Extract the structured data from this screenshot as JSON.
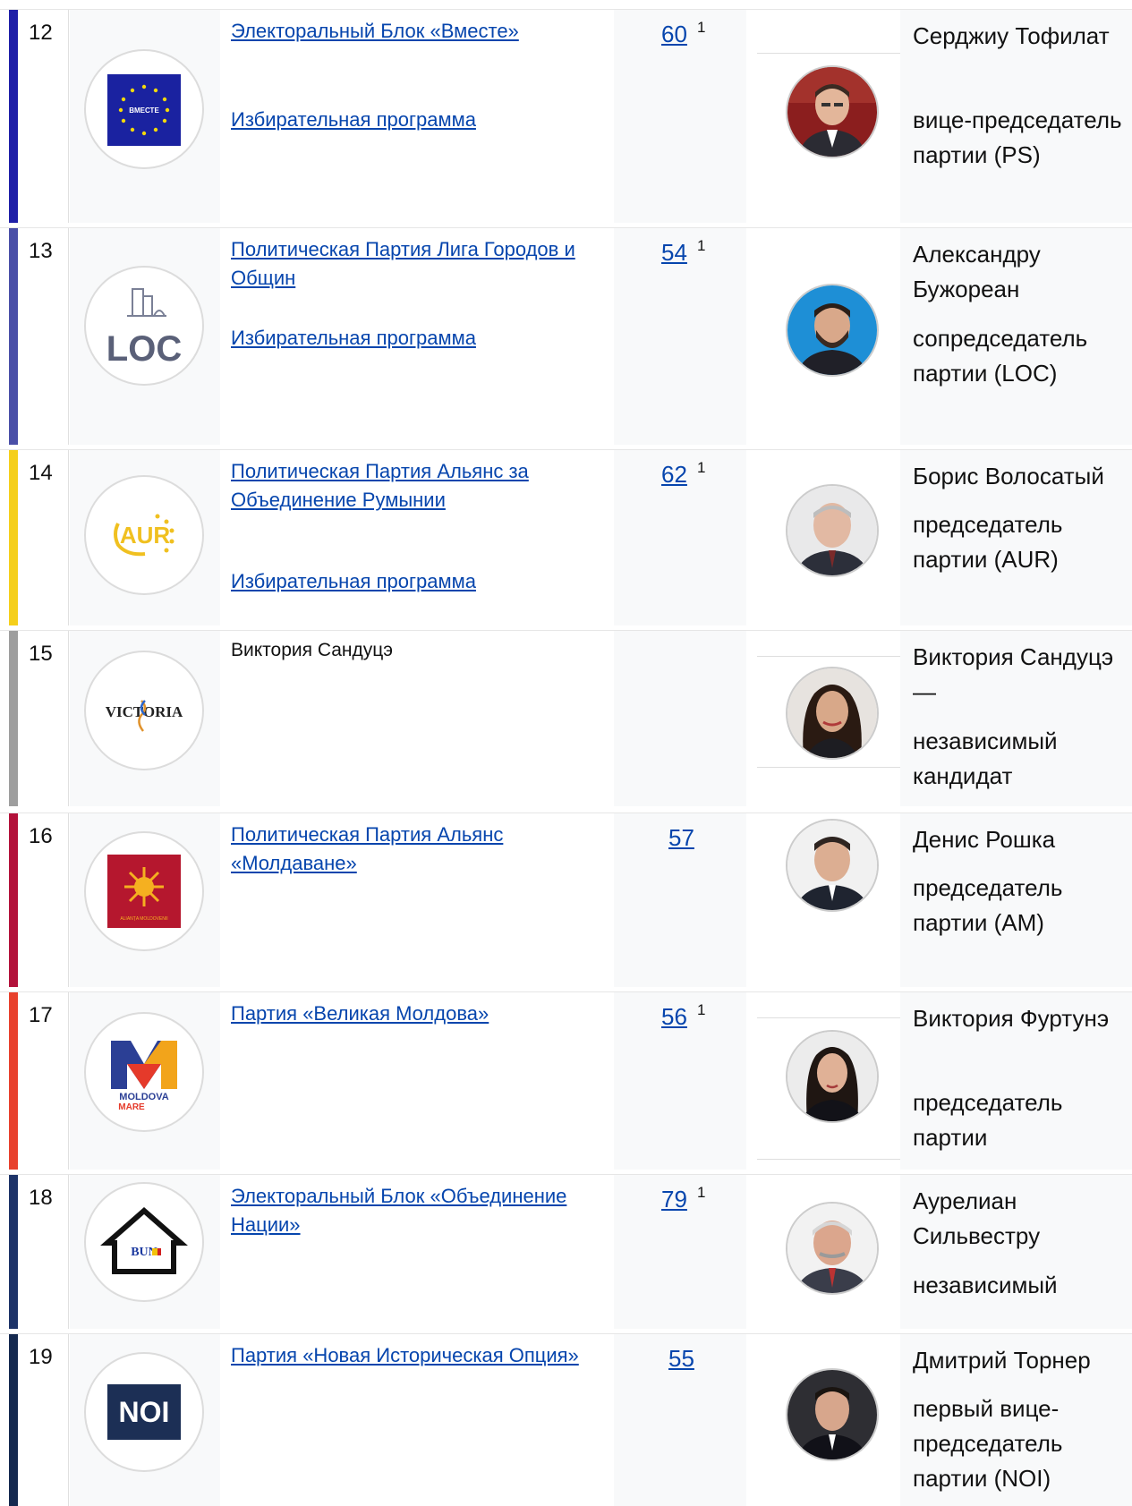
{
  "rows": [
    {
      "num": "12",
      "party": "Электоральный Блок «Вместе»",
      "program": "Избирательная программа",
      "seats": "60",
      "note": "1",
      "leader": "Серджиу Тофилат",
      "role": "вице-председатель партии (PS)",
      "stripe": "#1f1fa8"
    },
    {
      "num": "13",
      "party": "Политическая Партия Лига Городов и Общин",
      "program": "Избирательная программа",
      "seats": "54",
      "note": "1",
      "leader": "Александру Бужореан",
      "role": "сопредседатель партии (LOC)",
      "stripe": "#4a4fa8"
    },
    {
      "num": "14",
      "party": "Политическая Партия Альянс за Объединение Румынии",
      "program": "Избирательная программа",
      "seats": "62",
      "note": "1",
      "leader": "Борис Волосатый",
      "role": "председатель партии (AUR)",
      "stripe": "#f5cf1b"
    },
    {
      "num": "15",
      "party": "Виктория Сандуцэ",
      "program": "",
      "seats": "",
      "note": "",
      "leader": "Виктория Сандуцэ —",
      "role": "независимый кандидат",
      "stripe": "#9e9e9e"
    },
    {
      "num": "16",
      "party": "Политическая Партия Альянс «Молдаване»",
      "program": "",
      "seats": "57",
      "note": "",
      "leader": "Денис Рошка",
      "role": "председатель партии (AM)",
      "stripe": "#b3123b"
    },
    {
      "num": "17",
      "party": "Партия «Великая Молдова»",
      "program": "",
      "seats": "56",
      "note": "1",
      "leader": "Виктория Фуртунэ",
      "role": "председатель партии",
      "stripe": "#e8412d"
    },
    {
      "num": "18",
      "party": "Электоральный Блок «Объединение Нации»",
      "program": "",
      "seats": "79",
      "note": "1",
      "leader": "Аурелиан Сильвестру",
      "role": "независимый",
      "stripe": "#1d3368"
    },
    {
      "num": "19",
      "party": "Партия «Новая Историческая Опция»",
      "program": "",
      "seats": "55",
      "note": "",
      "leader": "Дмитрий Торнер",
      "role": "первый вице-председатель партии (NOI)",
      "stripe": "#15294f"
    }
  ],
  "logos": {
    "eu_caption": "ВМЕСТЕ",
    "loc_text": "LOC",
    "aur_text": "AUR",
    "victoria_text": "VICTORIA",
    "am_caption": "ALIANȚA MOLDOVENII",
    "mm_line1": "MOLDOVA",
    "mm_line2": "MARE",
    "bun_text": "BUN",
    "noi_text": "NOI"
  }
}
